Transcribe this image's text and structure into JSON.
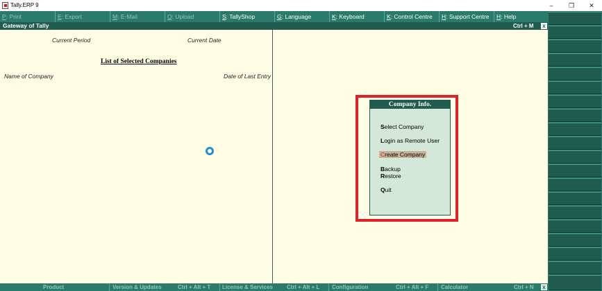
{
  "window": {
    "title": "Tally.ERP 9",
    "minimize": "–",
    "restore": "❐",
    "close": "✕"
  },
  "menu": [
    {
      "key": "P",
      "rest": ": Print",
      "state": "disabled"
    },
    {
      "key": "E",
      "rest": ": Export",
      "state": "disabled"
    },
    {
      "key": "M",
      "rest": ": E-Mail",
      "state": "disabled"
    },
    {
      "key": "O",
      "rest": ": Upload",
      "state": "disabled"
    },
    {
      "key": "S",
      "rest": ": TallyShop",
      "state": "active"
    },
    {
      "key": "G",
      "rest": ": Language",
      "state": "active"
    },
    {
      "key": "K",
      "rest": ": Keyboard",
      "state": "active"
    },
    {
      "key": "K",
      "rest": ": Control Centre",
      "state": "active"
    },
    {
      "key": "H",
      "rest": ": Support Centre",
      "state": "active"
    },
    {
      "key": "H",
      "rest": ": Help",
      "state": "active"
    }
  ],
  "gateway": {
    "title": "Gateway of Tally",
    "shortcut": "Ctrl + M",
    "close": "x"
  },
  "left": {
    "current_period_label": "Current Period",
    "current_date_label": "Current Date",
    "list_title": "List of Selected Companies",
    "name_header": "Name of Company",
    "date_header": "Date of Last Entry"
  },
  "company_info": {
    "title": "Company Info.",
    "options": [
      {
        "hot": "S",
        "rest": "elect Company"
      },
      {
        "hot": "L",
        "rest": "ogin as Remote User"
      },
      {
        "hot": "C",
        "rest": "reate Company",
        "selected": true
      },
      {
        "hot": "B",
        "rest": "ackup"
      },
      {
        "hot": "R",
        "rest": "estore"
      },
      {
        "hot": "Q",
        "rest": "uit"
      }
    ]
  },
  "bottombar": {
    "product": "Product",
    "version": "Version & Updates",
    "version_shortcut": "Ctrl + Alt + T",
    "license": "License & Services",
    "license_shortcut": "Ctrl + Alt + L",
    "configuration": "Configuration",
    "configuration_shortcut": "Ctrl + Alt + F",
    "calculator": "Calculator",
    "calculator_shortcut": "Ctrl + N"
  },
  "colors": {
    "menubar": "#2a7b6a",
    "panel": "#fffde3",
    "header_dark": "#1f5c4f",
    "highlight_border": "#e0202a",
    "selected_option": "#c8b298"
  },
  "icons": {
    "app": "tally-app-icon",
    "loading": "loading-spinner-icon"
  }
}
